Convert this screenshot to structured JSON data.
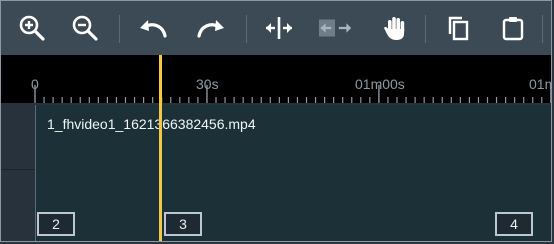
{
  "toolbar": {
    "buttons": [
      {
        "icon": "zoom-in-icon"
      },
      {
        "icon": "zoom-out-icon"
      },
      {
        "icon": "undo-icon"
      },
      {
        "icon": "redo-icon"
      },
      {
        "icon": "split-icon"
      },
      {
        "icon": "move-arrows-icon"
      },
      {
        "icon": "hand-icon"
      },
      {
        "icon": "copy-icon"
      },
      {
        "icon": "paste-icon"
      }
    ]
  },
  "ruler": {
    "labels": [
      "0",
      "30s",
      "01m00s",
      "01m"
    ]
  },
  "track": {
    "clip_name": "1_fhvideo1_1621366382456.mp4"
  },
  "markers": [
    "2",
    "3",
    "4"
  ],
  "colors": {
    "toolbar_bg": "#3c4a55",
    "ruler_bg": "#000000",
    "clip_bg": "#1c3038",
    "playhead": "#f5c843"
  }
}
